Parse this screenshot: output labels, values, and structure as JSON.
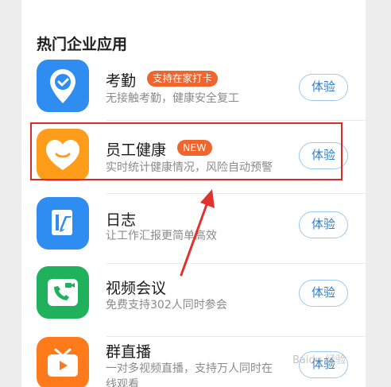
{
  "section": {
    "title": "热门企业应用"
  },
  "apps": [
    {
      "name": "考勤",
      "badge": "支持在家打卡",
      "desc": "无接触考勤，健康安全复工",
      "button": "体验",
      "icon": "location-check-icon",
      "color": "#2f8cf0"
    },
    {
      "name": "员工健康",
      "badge": "NEW",
      "desc": "实时统计健康情况，风险自动预警",
      "button": "体验",
      "icon": "heart-smile-icon",
      "color": "#ff9d1a"
    },
    {
      "name": "日志",
      "desc": "让工作汇报更简单高效",
      "button": "体验",
      "icon": "log-edit-icon",
      "color": "#2f8cf0"
    },
    {
      "name": "视频会议",
      "desc": "免费支持302人同时参会",
      "button": "体验",
      "icon": "video-call-icon",
      "color": "#1fb15c"
    },
    {
      "name": "群直播",
      "desc": "一对多视频直播，支持万人同时在线观看",
      "desc_line1": "一对多视频直播，支持万人同时在",
      "desc_line2": "线观看",
      "button": "体验",
      "icon": "tv-live-icon",
      "color": "#ff7a1a"
    }
  ],
  "colors": {
    "accent": "#2c7fd2",
    "badge": "#f0652e",
    "highlight": "#d92a2a"
  }
}
